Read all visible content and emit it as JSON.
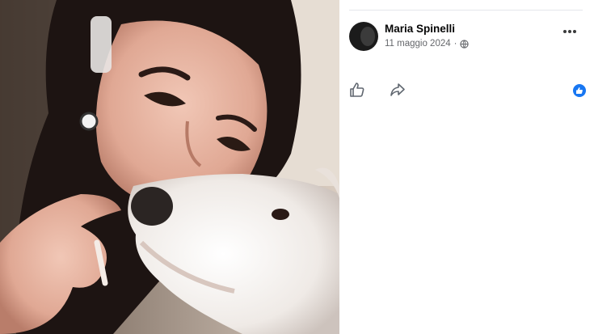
{
  "post": {
    "author_name": "Maria Spinelli",
    "date": "11 maggio 2024",
    "separator": "·",
    "privacy_icon": "globe-icon",
    "more_icon": "more-options-icon"
  },
  "actions": {
    "like_icon": "thumbs-up-icon",
    "share_icon": "share-arrow-icon",
    "reaction_icon": "like-reaction-badge-icon"
  },
  "colors": {
    "accent": "#1877f2",
    "text_primary": "#050505",
    "text_secondary": "#65676b"
  }
}
